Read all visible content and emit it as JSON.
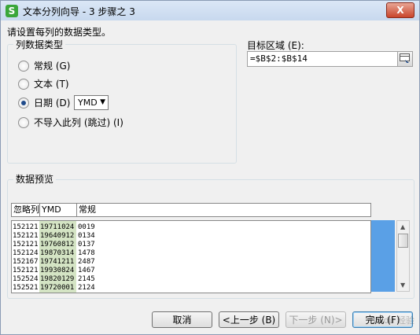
{
  "window": {
    "app_icon_letter": "S",
    "title": "文本分列向导 - 3 步骤之 3",
    "close_label": "X"
  },
  "instruction": "请设置每列的数据类型。",
  "column_type": {
    "group_label": "列数据类型",
    "options": [
      {
        "label": "常规 (G)",
        "checked": false
      },
      {
        "label": "文本 (T)",
        "checked": false
      },
      {
        "label": "日期 (D)",
        "checked": true
      },
      {
        "label": "不导入此列 (跳过) (I)",
        "checked": false
      }
    ],
    "date_format": "YMD"
  },
  "target": {
    "label": "目标区域 (E):",
    "value": "=$B$2:$B$14"
  },
  "preview": {
    "group_label": "数据预览",
    "columns": [
      "忽略列",
      "YMD",
      "常规"
    ],
    "rows": [
      [
        "152121",
        "19711024",
        "0019"
      ],
      [
        "152121",
        "19640912",
        "0134"
      ],
      [
        "152121",
        "19760812",
        "0137"
      ],
      [
        "152124",
        "19870314",
        "1478"
      ],
      [
        "152167",
        "19741211",
        "2487"
      ],
      [
        "152121",
        "19930824",
        "1467"
      ],
      [
        "152524",
        "19820129",
        "2145"
      ],
      [
        "152521",
        "19720001",
        "2124"
      ]
    ]
  },
  "buttons": {
    "cancel": "取消",
    "back": "<上一步 (B)",
    "next": "下一步 (N)>",
    "finish": "完成 (F)"
  },
  "watermark": "Baidu 经验",
  "colors": {
    "ymd_column": "#d4e4c4",
    "preview_side_bar": "#5aa0e6",
    "title_bar": "#c7d8ee"
  }
}
